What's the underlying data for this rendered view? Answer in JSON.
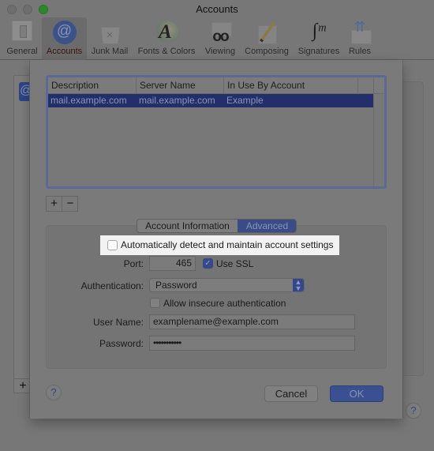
{
  "window": {
    "title": "Accounts"
  },
  "toolbar": {
    "items": [
      {
        "label": "General",
        "icon": "general-switch-icon",
        "active": false
      },
      {
        "label": "Accounts",
        "icon": "at-sign-icon",
        "active": true
      },
      {
        "label": "Junk Mail",
        "icon": "junk-mail-bin-icon",
        "active": false
      },
      {
        "label": "Fonts & Colors",
        "icon": "fonts-colors-icon",
        "active": false
      },
      {
        "label": "Viewing",
        "icon": "glasses-icon",
        "active": false
      },
      {
        "label": "Composing",
        "icon": "pencil-icon",
        "active": false
      },
      {
        "label": "Signatures",
        "icon": "signature-icon",
        "active": false
      },
      {
        "label": "Rules",
        "icon": "rules-envelope-icon",
        "active": false
      }
    ]
  },
  "background": {
    "add_label": "+",
    "help_label": "?"
  },
  "sheet": {
    "table": {
      "columns": [
        "Description",
        "Server Name",
        "In Use By Account"
      ],
      "rows": [
        {
          "description": "mail.example.com",
          "server_name": "mail.example.com",
          "in_use_by": "Example",
          "selected": true
        }
      ]
    },
    "add_label": "+",
    "remove_label": "−",
    "tabs": [
      {
        "label": "Account Information",
        "selected": false
      },
      {
        "label": "Advanced",
        "selected": true
      }
    ],
    "advanced": {
      "auto_detect": {
        "label": "Automatically detect and maintain account settings",
        "checked": false
      },
      "port": {
        "label": "Port:",
        "value": "465"
      },
      "use_ssl": {
        "label": "Use SSL",
        "checked": true,
        "checkmark": "✓"
      },
      "authentication": {
        "label": "Authentication:",
        "value": "Password",
        "arrows": "⌃⌄"
      },
      "allow_insecure": {
        "label": "Allow insecure authentication",
        "checked": false
      },
      "user_name": {
        "label": "User Name:",
        "value": "examplename@example.com"
      },
      "password": {
        "label": "Password:",
        "value": "•••••••••••"
      }
    },
    "help_label": "?",
    "cancel_label": "Cancel",
    "ok_label": "OK"
  },
  "colors": {
    "selection": "#232f6a",
    "accent": "#3a5090",
    "spotlight": "#f2f2f2",
    "dim_background": "#777777"
  }
}
